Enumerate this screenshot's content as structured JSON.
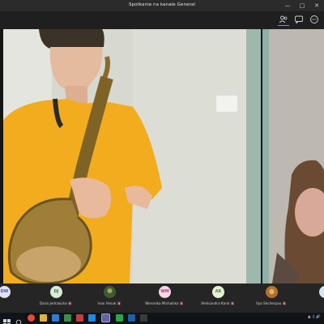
{
  "window": {
    "title": "Spotkanie na kanale General"
  },
  "toolbar": {
    "icons": [
      "people-icon",
      "chat-icon",
      "more-icon"
    ]
  },
  "participants": [
    {
      "initials": "DW",
      "name": "",
      "color": "#dfe3f1",
      "text_color": "#4f52b2",
      "photo": false
    },
    {
      "initials": "DJ",
      "name": "Daria Jedrzejcka",
      "color": "#dcebd7",
      "text_color": "#4a7a43",
      "photo": false
    },
    {
      "initials": "",
      "name": "Ivan Vesuk",
      "color": "#4d6a3a",
      "text_color": "#ffffff",
      "photo": true
    },
    {
      "initials": "WM",
      "name": "Weronika Michalska",
      "color": "#f6d7e6",
      "text_color": "#b03b7a",
      "photo": false
    },
    {
      "initials": "AK",
      "name": "Aleksandra Karol",
      "color": "#e4f0d6",
      "text_color": "#5a7d36",
      "photo": false
    },
    {
      "initials": "",
      "name": "Ilya Shcherpau",
      "color": "#c78a3e",
      "text_color": "#ffffff",
      "photo": true
    },
    {
      "initials": "",
      "name": "",
      "color": "#d6e4f6",
      "text_color": "#3a5a8a",
      "photo": false
    }
  ],
  "colors": {
    "accent": "#8b8cc7",
    "titlebar": "#2b2b2b",
    "background": "#1f1f1f"
  }
}
